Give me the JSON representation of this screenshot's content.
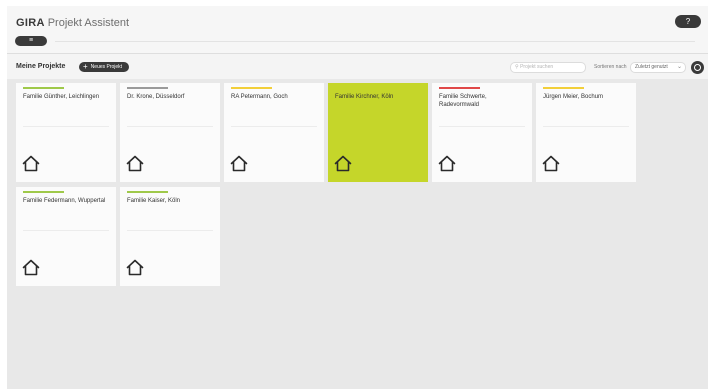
{
  "header": {
    "brand": "GIRA",
    "app_name": "Projekt Assistent",
    "help_label": "?",
    "menu_label": "≡"
  },
  "toolbar": {
    "section_title": "Meine Projekte",
    "new_project_label": "Neues Projekt",
    "search_placeholder": "Projekt suchen",
    "sort_label": "Sortieren nach",
    "sort_value": "Zuletzt genutzt"
  },
  "colors": {
    "accent": "#c5d62a",
    "dark": "#3a3a3a"
  },
  "projects": [
    {
      "name": "Familie Günther, Leichlingen",
      "bar_color": "#9fc94a",
      "active": false
    },
    {
      "name": "Dr. Krone, Düsseldorf",
      "bar_color": "#9a9a9a",
      "active": false
    },
    {
      "name": "RA Petermann, Goch",
      "bar_color": "#f2cf3a",
      "active": false
    },
    {
      "name": "Familie Kirchner, Köln",
      "bar_color": "#c5d62a",
      "active": true
    },
    {
      "name": "Familie Schwerte, Radevormwald",
      "bar_color": "#e04848",
      "active": false
    },
    {
      "name": "Jürgen Meier, Bochum",
      "bar_color": "#f2cf3a",
      "active": false
    },
    {
      "name": "Familie Federmann, Wuppertal",
      "bar_color": "#9fc94a",
      "active": false
    },
    {
      "name": "Familie Kaiser, Köln",
      "bar_color": "#9fc94a",
      "active": false
    }
  ]
}
